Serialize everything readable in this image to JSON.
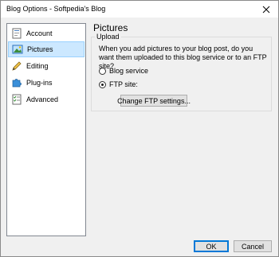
{
  "window": {
    "title": "Blog Options - Softpedia's Blog",
    "close_icon": "close-icon"
  },
  "sidebar": {
    "items": [
      {
        "label": "Account",
        "icon": "account-icon",
        "selected": false
      },
      {
        "label": "Pictures",
        "icon": "pictures-icon",
        "selected": true
      },
      {
        "label": "Editing",
        "icon": "pencil-icon",
        "selected": false
      },
      {
        "label": "Plug-ins",
        "icon": "puzzle-icon",
        "selected": false
      },
      {
        "label": "Advanced",
        "icon": "checklist-icon",
        "selected": false
      }
    ]
  },
  "page": {
    "title": "Pictures",
    "group_label": "Upload",
    "description": "When you add pictures to your blog post, do you want them uploaded to this blog service or to an FTP site?",
    "options": [
      {
        "label": "Blog service",
        "checked": false
      },
      {
        "label": "FTP site:",
        "checked": true
      }
    ],
    "ftp_button": "Change FTP settings..."
  },
  "footer": {
    "ok": "OK",
    "cancel": "Cancel"
  },
  "colors": {
    "selection_bg": "#cce8ff",
    "selection_border": "#99d1ff",
    "default_button_border": "#0078d7"
  }
}
